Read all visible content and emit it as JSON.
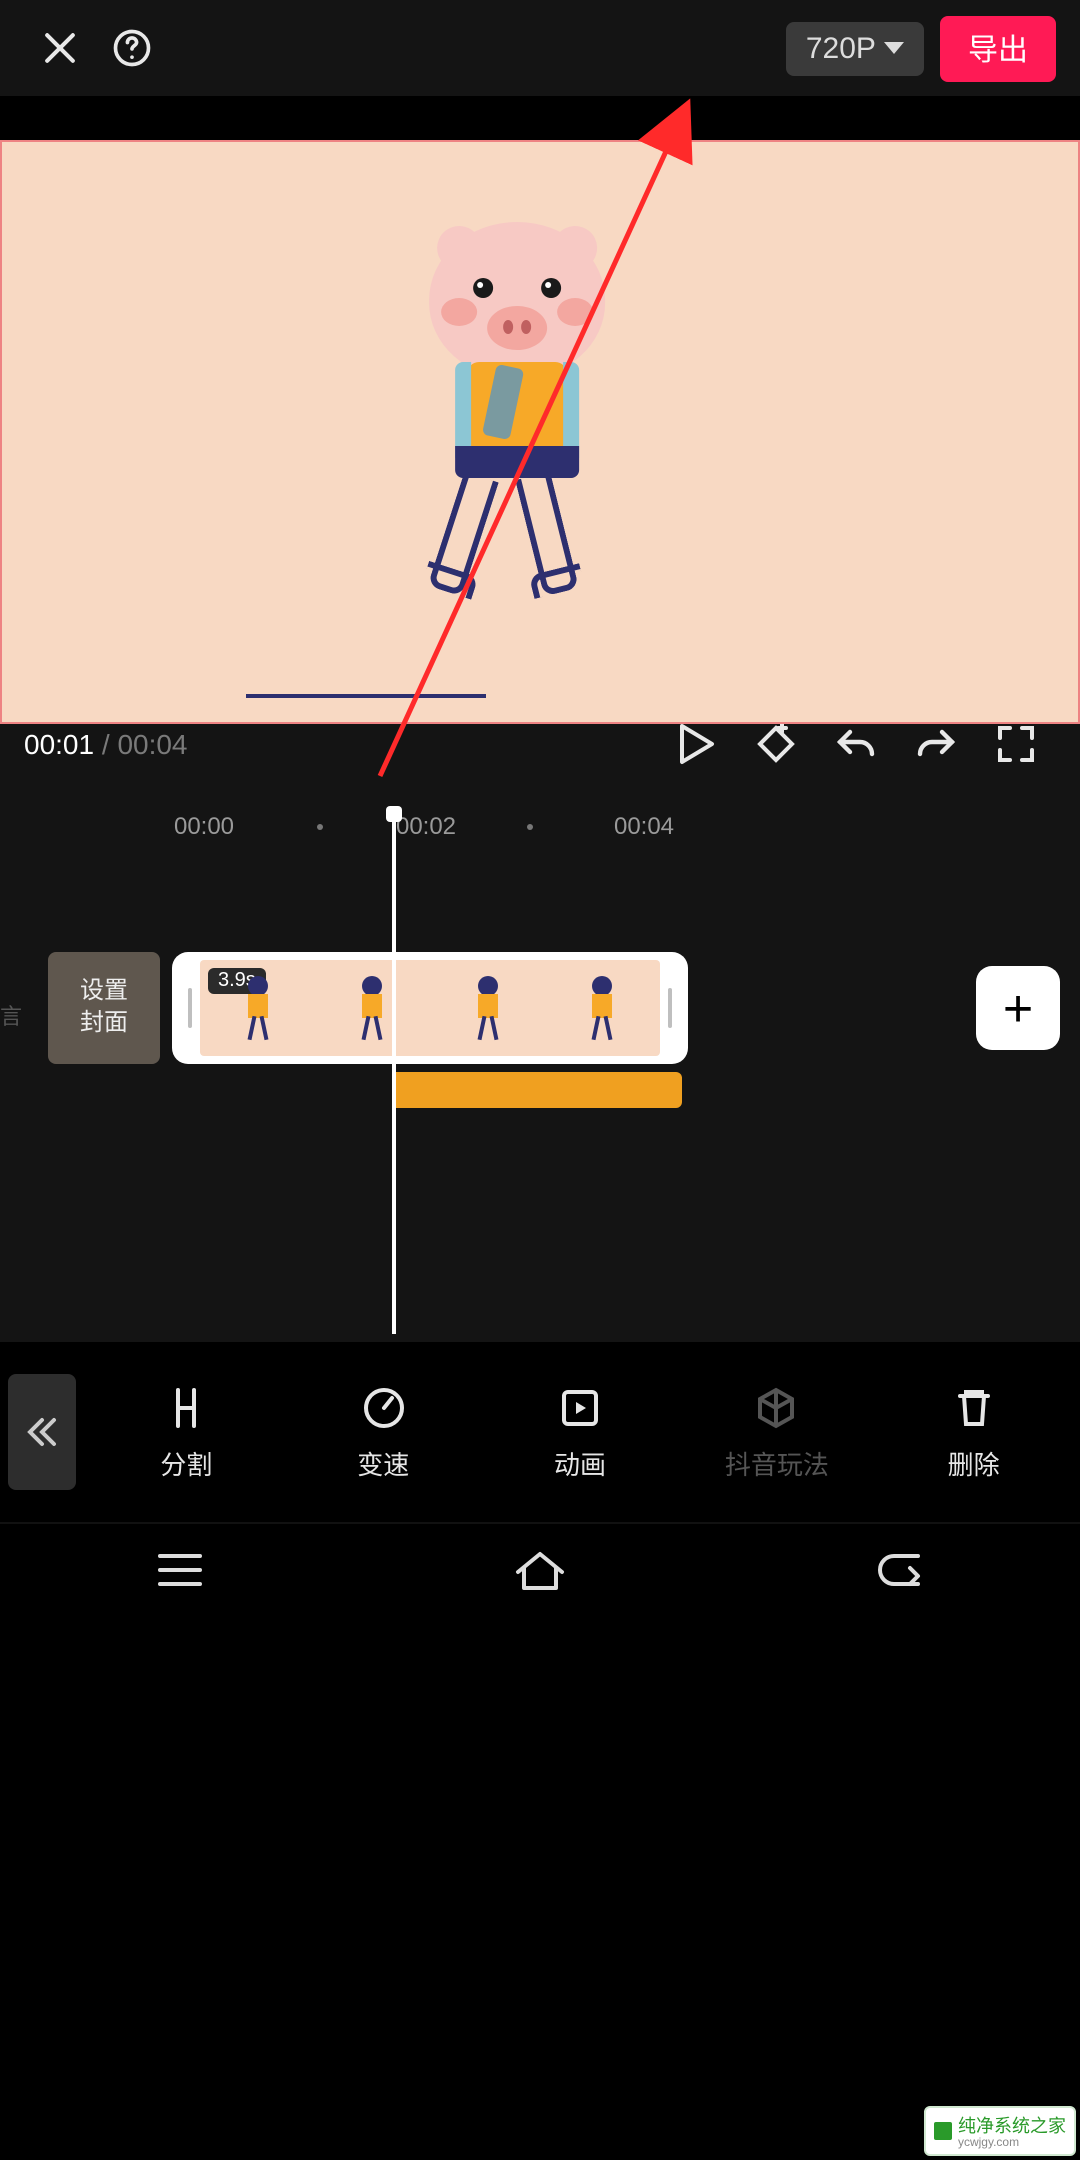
{
  "header": {
    "resolution_label": "720P",
    "export_label": "导出"
  },
  "playback": {
    "current_time": "00:01",
    "separator": " / ",
    "total_time": "00:04"
  },
  "ruler": {
    "ticks": [
      "00:00",
      "00:02",
      "00:04"
    ]
  },
  "timeline": {
    "cover_button_label": "设置\n封面",
    "clip_duration_badge": "3.9s",
    "add_button_label": "+",
    "track_hint": "言"
  },
  "toolbar": {
    "items": [
      {
        "id": "split",
        "label": "分割",
        "disabled": false
      },
      {
        "id": "speed",
        "label": "变速",
        "disabled": false
      },
      {
        "id": "anim",
        "label": "动画",
        "disabled": false
      },
      {
        "id": "douyin",
        "label": "抖音玩法",
        "disabled": true
      },
      {
        "id": "delete",
        "label": "删除",
        "disabled": false
      }
    ]
  },
  "watermark": {
    "brand": "纯净系统之家",
    "url": "ycwjgy.com"
  }
}
